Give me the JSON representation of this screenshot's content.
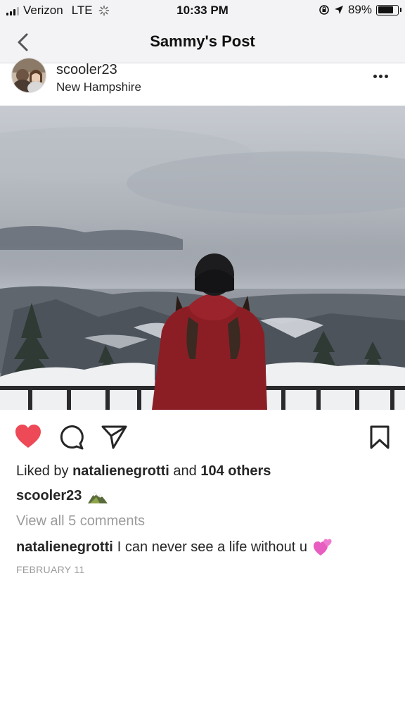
{
  "status_bar": {
    "carrier": "Verizon",
    "network": "LTE",
    "time": "10:33 PM",
    "battery_percent": "89%",
    "battery_level": 0.89
  },
  "nav": {
    "title": "Sammy's Post",
    "back_icon": "chevron-left-icon"
  },
  "post": {
    "username": "scooler23",
    "location": "New Hampshire",
    "more_icon": "more-dots-icon"
  },
  "actions": {
    "like_icon": "heart-filled-icon",
    "comment_icon": "comment-icon",
    "share_icon": "share-icon",
    "save_icon": "bookmark-icon",
    "like_color": "#ed4956"
  },
  "likes": {
    "prefix": "Liked by",
    "user": "natalienegrotti",
    "middle": "and",
    "others": "104 others"
  },
  "caption": {
    "username": "scooler23",
    "emoji": "mountain-emoji"
  },
  "comments": {
    "view_all": "View all 5 comments",
    "items": [
      {
        "username": "natalienegrotti",
        "text": "I can never see a life without u",
        "emoji": "two-hearts-emoji"
      }
    ]
  },
  "date": "FEBRUARY 11"
}
